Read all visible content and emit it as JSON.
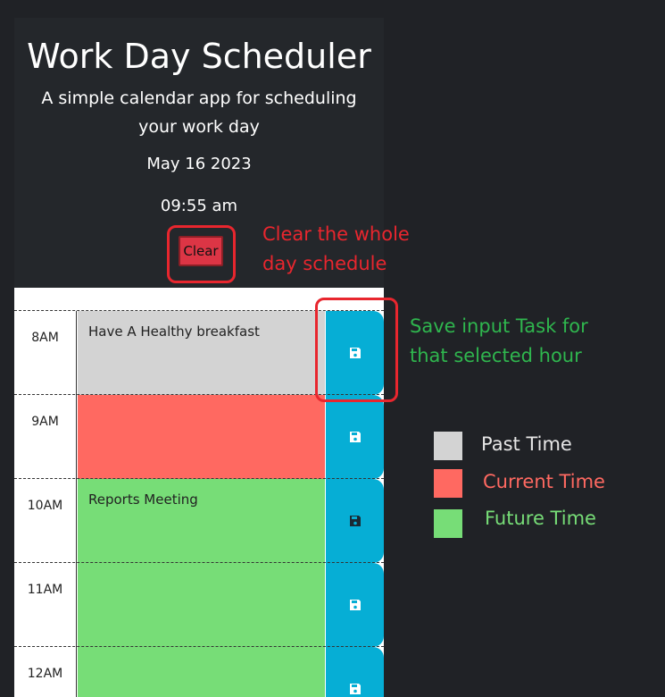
{
  "app": {
    "title": "Work Day Scheduler",
    "subtitle": "A simple calendar app for scheduling your work day",
    "date": "May 16 2023",
    "time": "09:55 am",
    "clear_label": "Clear"
  },
  "schedule": {
    "rows": [
      {
        "hour": "8AM",
        "task": "Have A Healthy breakfast",
        "status": "past"
      },
      {
        "hour": "9AM",
        "task": "",
        "status": "present"
      },
      {
        "hour": "10AM",
        "task": "Reports Meeting",
        "status": "future"
      },
      {
        "hour": "11AM",
        "task": "",
        "status": "future"
      },
      {
        "hour": "12AM",
        "task": "",
        "status": "future"
      }
    ],
    "save_icon": "floppy-disk-icon"
  },
  "annotations": {
    "clear_note": "Clear the whole day schedule",
    "save_note": "Save input Task for that selected hour"
  },
  "legend": {
    "items": [
      {
        "label": "Past Time",
        "color": "#d3d3d3",
        "text_color": "#e6e6e6"
      },
      {
        "label": "Current Time",
        "color": "#ff6961",
        "text_color": "#ff6961"
      },
      {
        "label": "Future Time",
        "color": "#77dd77",
        "text_color": "#77dd77"
      }
    ]
  },
  "colors": {
    "past": "#d3d3d3",
    "present": "#ff6961",
    "future": "#77dd77",
    "save_button": "#06aed5",
    "clear_button": "#dc3545",
    "annotation_red": "#e8262e",
    "annotation_green": "#2fb64e"
  }
}
